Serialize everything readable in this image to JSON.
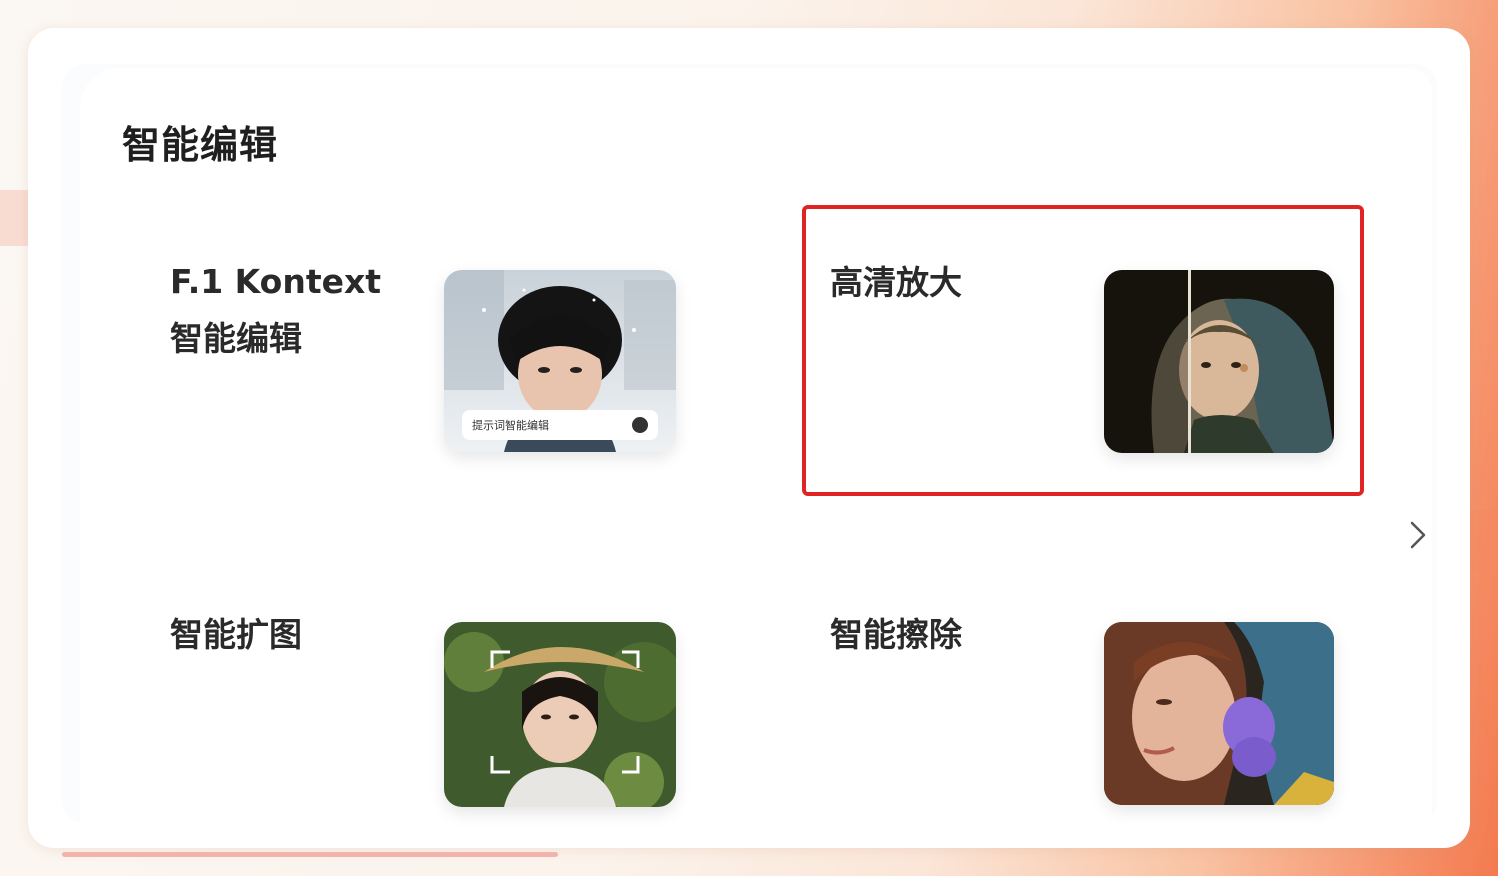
{
  "section": {
    "title": "智能编辑"
  },
  "cards": [
    {
      "id": "kontext",
      "label_line1": "F.1 Kontext",
      "label_line2": "智能编辑",
      "prompt_text": "提示词智能编辑"
    },
    {
      "id": "upscale",
      "label_line1": "高清放大",
      "label_line2": ""
    },
    {
      "id": "outpaint",
      "label_line1": "智能扩图",
      "label_line2": ""
    },
    {
      "id": "erase",
      "label_line1": "智能擦除",
      "label_line2": ""
    }
  ],
  "colors": {
    "highlight": "#e02424",
    "title_text": "#1f1f1f",
    "accent_orange": "#f47a4f"
  },
  "icons": {
    "next": "chevron-right-icon",
    "send": "send-icon"
  }
}
